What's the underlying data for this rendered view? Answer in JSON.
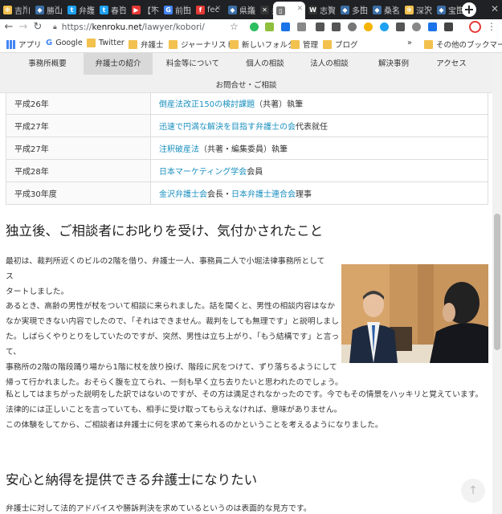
{
  "browser": {
    "tabs": [
      {
        "title": "吉川",
        "color": "#f2c14e",
        "glyph": "✻"
      },
      {
        "title": "勝山",
        "color": "#3b6ea5",
        "glyph": "◆"
      },
      {
        "title": "弁護",
        "color": "#1da1f2",
        "glyph": "t"
      },
      {
        "title": "春日",
        "color": "#1da1f2",
        "glyph": "t"
      },
      {
        "title": "【不",
        "color": "#e53935",
        "glyph": "▶"
      },
      {
        "title": "前田",
        "color": "#4285f4",
        "glyph": "G"
      },
      {
        "title": "fec",
        "color": "#e53935",
        "glyph": "f"
      },
      {
        "title": "県議",
        "color": "#3b6ea5",
        "glyph": "◆"
      },
      {
        "title": "弁護",
        "color": "#333333",
        "glyph": "✕"
      },
      {
        "title": "",
        "color": "#777777",
        "glyph": "▯"
      },
      {
        "title": "志賀",
        "color": "#333333",
        "glyph": "W"
      },
      {
        "title": "多田",
        "color": "#3b6ea5",
        "glyph": "◆"
      },
      {
        "title": "桑名",
        "color": "#3b6ea5",
        "glyph": "◆"
      },
      {
        "title": "深沢",
        "color": "#f2c14e",
        "glyph": "✻"
      },
      {
        "title": "宝田",
        "color": "#3b6ea5",
        "glyph": "◆"
      }
    ],
    "url_scheme": "https://",
    "url_host": "kenroku.net",
    "url_path": "/lawyer/kobori/",
    "bookmarks": [
      "アプリ",
      "Google",
      "Twitter",
      "弁護士",
      "ジャーナリスト",
      "新しいフォルダ",
      "管理",
      "ブログ"
    ],
    "bookmarks_more": "»",
    "other_bookmarks": "その他のブックマーク"
  },
  "site_nav": {
    "items": [
      "事務所概要",
      "弁護士の紹介",
      "料金等について",
      "個人の相談",
      "法人の相談",
      "解決事例",
      "アクセス"
    ],
    "active_index": 1,
    "contact": "お問合せ・ご相談"
  },
  "history_rows": [
    {
      "year": "平成26年",
      "link": "倒産法改正150の検討課題",
      "suffix": "（共著）執筆"
    },
    {
      "year": "平成27年",
      "link": "迅速で円満な解決を目指す弁護士の会",
      "suffix": "代表就任"
    },
    {
      "year": "平成27年",
      "link": "注釈破産法",
      "suffix": "（共著・編集委員）執筆"
    },
    {
      "year": "平成28年",
      "link": "日本マーケティング学会",
      "suffix": "会員"
    },
    {
      "year": "平成30年度",
      "link": "金沢弁護士会",
      "suffix": "会長・",
      "link2": "日本弁護士連合会",
      "suffix2": "理事"
    }
  ],
  "section1": {
    "heading": "独立後、ご相談者にお叱りを受け、気付かされたこと",
    "p1": [
      "最初は、裁判所近くのビルの2階を借り、弁護士一人、事務員二人で小堀法律事務所としてス",
      "タートしました。"
    ],
    "p2": [
      "あるとき、高齢の男性が杖をついて相談に来られました。話を聞くと、男性の相談内容はなか",
      "なか実現できない内容でしたので、「それはできません。裁判をしても無理です」と説明しまし",
      "た。しばらくやりとりをしていたのですが、突然、男性は立ち上がり、「もう結構です」と言って、",
      "事務所の2階の階段踊り場から1階に杖を放り投げ、階段に尻をつけて、ずり落ちるようにして",
      "帰って行かれました。おそらく腹を立てられ、一刻も早く立ち去りたいと思われたのでしょう。"
    ],
    "p3": [
      "私としてはまちがった説明をした訳ではないのですが、その方は満足されなかったのです。今でもその情景をハッキリと覚えています。",
      "法律的には正しいことを言っていても、相手に受け取ってもらえなければ、意味がありません。",
      "この体験をしてから、ご相談者は弁護士に何を求めて来られるのかということを考えるようになりました。"
    ]
  },
  "section2": {
    "heading": "安心と納得を提供できる弁護士になりたい",
    "p1": "弁護士に対して法的アドバイスや勝訴判決を求めているというのは表面的な見方です。"
  },
  "to_top": "↑"
}
